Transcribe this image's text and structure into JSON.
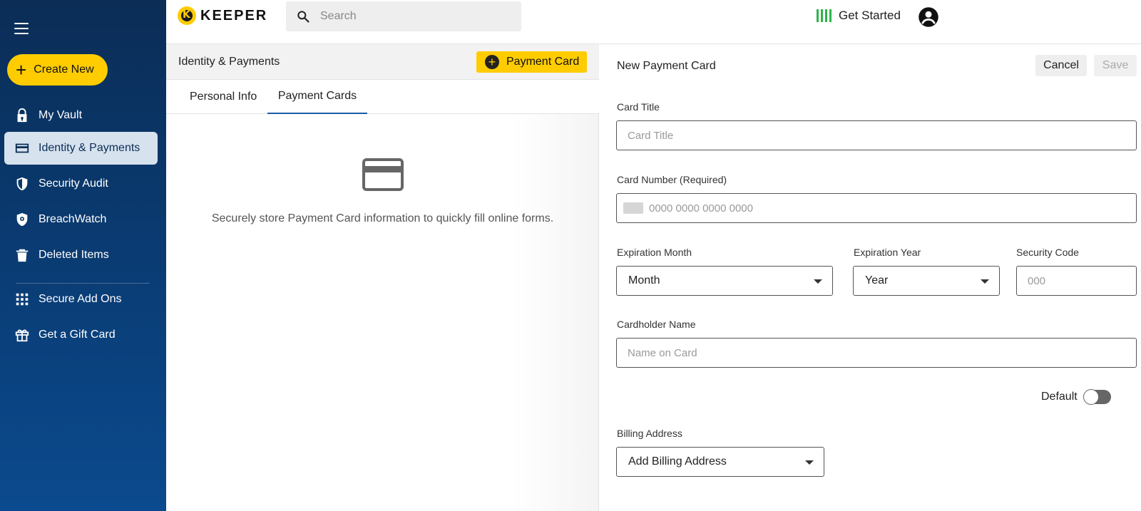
{
  "sidebar": {
    "create_label": "Create New",
    "items": [
      {
        "label": "My Vault",
        "icon": "lock-icon"
      },
      {
        "label": "Identity & Payments",
        "icon": "credit-card-icon"
      },
      {
        "label": "Security Audit",
        "icon": "shield-icon"
      },
      {
        "label": "BreachWatch",
        "icon": "breachwatch-icon"
      },
      {
        "label": "Deleted Items",
        "icon": "trash-icon"
      },
      {
        "label": "Secure Add Ons",
        "icon": "grid-icon"
      },
      {
        "label": "Get a Gift Card",
        "icon": "gift-icon"
      }
    ]
  },
  "header": {
    "logo_text": "KEEPER",
    "search_placeholder": "Search",
    "get_started": "Get Started"
  },
  "middle": {
    "title": "Identity & Payments",
    "add_button": "Payment Card",
    "tabs": [
      {
        "label": "Personal Info"
      },
      {
        "label": "Payment Cards",
        "active": true
      }
    ],
    "empty_text": "Securely store Payment Card information to quickly fill online forms."
  },
  "form": {
    "title": "New Payment Card",
    "cancel": "Cancel",
    "save": "Save",
    "card_title_label": "Card Title",
    "card_title_placeholder": "Card Title",
    "card_number_label": "Card Number (Required)",
    "card_number_placeholder": "0000 0000 0000 0000",
    "exp_month_label": "Expiration Month",
    "exp_month_value": "Month",
    "exp_year_label": "Expiration Year",
    "exp_year_value": "Year",
    "security_code_label": "Security Code",
    "security_code_placeholder": "000",
    "cardholder_label": "Cardholder Name",
    "cardholder_placeholder": "Name on Card",
    "default_label": "Default",
    "default_on": false,
    "billing_label": "Billing Address",
    "billing_value": "Add Billing Address"
  },
  "colors": {
    "accent_yellow": "#ffcc00",
    "sidebar_navy": "#0b2d56",
    "tab_underline": "#1a5ea8",
    "get_started_green": "#2db34a"
  }
}
